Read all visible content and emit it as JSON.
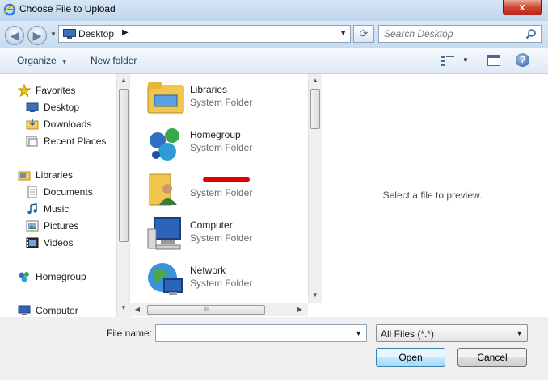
{
  "window": {
    "title": "Choose File to Upload",
    "close_label": "x"
  },
  "address": {
    "location": "Desktop",
    "search_placeholder": "Search Desktop"
  },
  "toolbar": {
    "organize_label": "Organize",
    "new_folder_label": "New folder",
    "help_label": "?"
  },
  "sidebar": {
    "items": [
      {
        "label": "Favorites",
        "icon": "star-icon"
      },
      {
        "label": "Desktop",
        "icon": "desktop-icon"
      },
      {
        "label": "Downloads",
        "icon": "downloads-folder-icon"
      },
      {
        "label": "Recent Places",
        "icon": "recent-places-icon"
      },
      {
        "label": "Libraries",
        "icon": "libraries-icon"
      },
      {
        "label": "Documents",
        "icon": "documents-icon"
      },
      {
        "label": "Music",
        "icon": "music-icon"
      },
      {
        "label": "Pictures",
        "icon": "pictures-icon"
      },
      {
        "label": "Videos",
        "icon": "videos-icon"
      },
      {
        "label": "Homegroup",
        "icon": "homegroup-icon"
      },
      {
        "label": "Computer",
        "icon": "computer-icon"
      }
    ]
  },
  "files": [
    {
      "name": "Libraries",
      "type": "System Folder",
      "icon": "libraries-folder-icon"
    },
    {
      "name": "Homegroup",
      "type": "System Folder",
      "icon": "homegroup-icon"
    },
    {
      "name": "",
      "type": "System Folder",
      "icon": "user-folder-icon",
      "name_redacted": true
    },
    {
      "name": "Computer",
      "type": "System Folder",
      "icon": "computer-icon"
    },
    {
      "name": "Network",
      "type": "System Folder",
      "icon": "network-icon"
    }
  ],
  "preview": {
    "message": "Select a file to preview."
  },
  "bottom": {
    "file_name_label": "File name:",
    "file_name_value": "",
    "file_type_selected": "All Files (*.*)",
    "open_label": "Open",
    "cancel_label": "Cancel"
  }
}
